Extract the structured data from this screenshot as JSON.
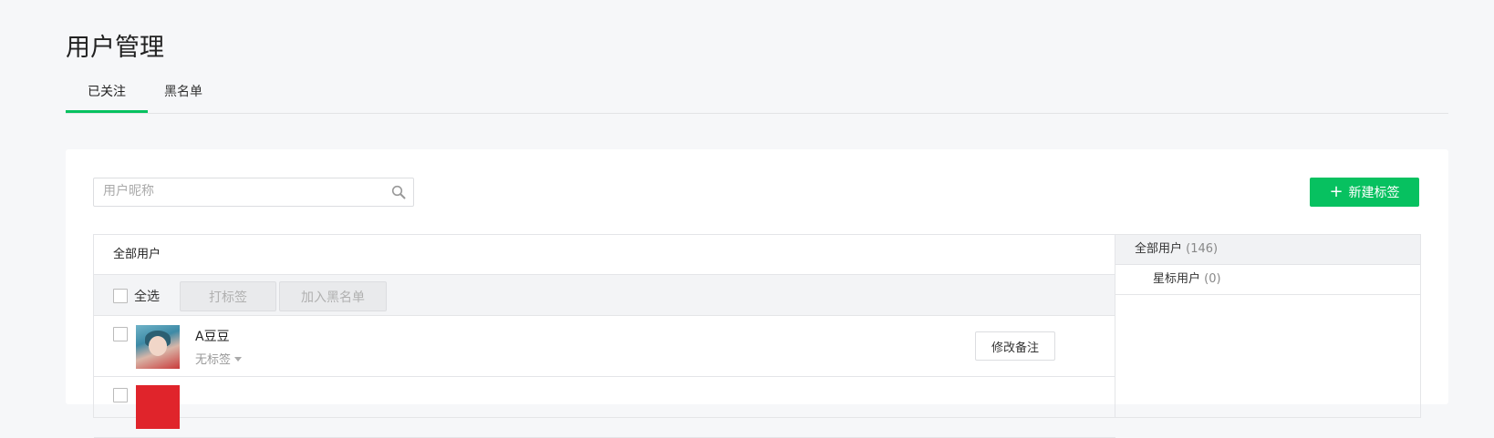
{
  "page": {
    "title": "用户管理"
  },
  "tabs": [
    {
      "label": "已关注",
      "active": true
    },
    {
      "label": "黑名单",
      "active": false
    }
  ],
  "search": {
    "placeholder": "用户昵称",
    "icon": "search-icon"
  },
  "toolbar": {
    "new_tag_label": "新建标签",
    "select_all_label": "全选",
    "tag_button_label": "打标签",
    "blacklist_button_label": "加入黑名单"
  },
  "group_panel": {
    "title": "全部用户"
  },
  "users": [
    {
      "name": "A豆豆",
      "tag": "无标签",
      "action_label": "修改备注"
    }
  ],
  "groups": [
    {
      "label": "全部用户",
      "count": "(146)",
      "active": true
    },
    {
      "label": "星标用户",
      "count": "(0)",
      "active": false
    }
  ],
  "colors": {
    "accent": "#07c160",
    "background": "#f6f7f9"
  }
}
